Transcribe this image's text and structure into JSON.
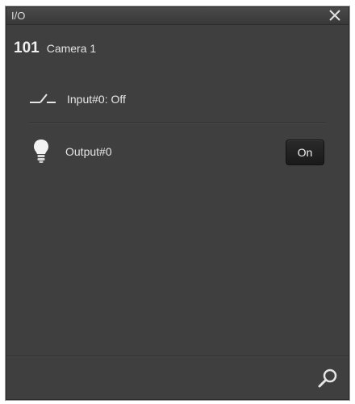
{
  "window": {
    "title": "I/O"
  },
  "camera": {
    "number": "101",
    "name": "Camera 1"
  },
  "io": {
    "input_label": "Input#0: Off",
    "output_label": "Output#0",
    "output_button_label": "On"
  },
  "icons": {
    "close": "close-icon",
    "input": "switch-off-icon",
    "output": "light-bulb-icon",
    "search": "search-icon"
  },
  "colors": {
    "panel_bg": "#3f3f3f",
    "button_bg": "#1f1f1f",
    "text": "#e6e6e6"
  }
}
